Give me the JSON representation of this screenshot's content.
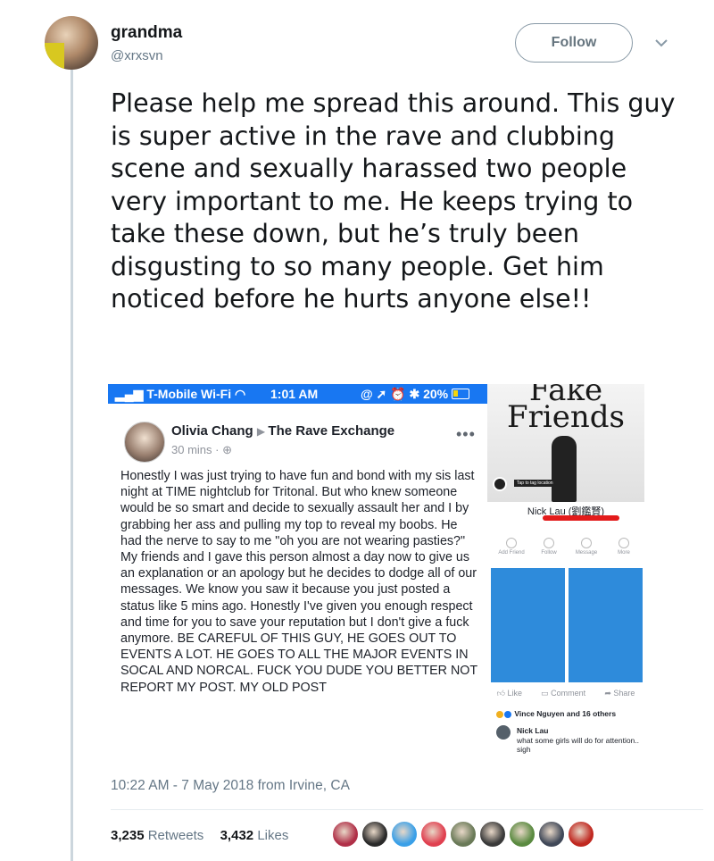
{
  "user": {
    "name": "grandma",
    "handle": "@xrxsvn"
  },
  "follow_label": "Follow",
  "tweet_text": "Please help me spread this around. This guy is super active in the rave and clubbing scene and sexually harassed two people very important to me. He keeps trying to take these down, but he’s truly been disgusting to so many people. Get him noticed before he hurts anyone else!!",
  "screenshot": {
    "status_bar": {
      "carrier": "T-Mobile Wi-Fi",
      "time": "1:01 AM",
      "battery": "20%"
    },
    "post": {
      "author": "Olivia Chang",
      "group": "The Rave Exchange",
      "time": "30 mins",
      "body": "Honestly I was just trying to have fun and bond with my sis last night at TIME nightclub for Tritonal. But who knew someone would be so smart and decide to sexually assault her and I by grabbing her ass and pulling my top to reveal my boobs. He had the nerve to say to me \"oh you are not wearing pasties?\"  My friends and I gave this person almost a day now to give us an explanation or an apology but he decides to dodge all of our messages. We know you saw it because you just posted a status like 5 mins ago. Honestly I've given you enough respect and time for you to save your reputation but I don't give a fuck anymore. BE CAREFUL OF THIS GUY, HE GOES OUT TO EVENTS A LOT. HE GOES TO ALL THE MAJOR EVENTS IN SOCAL AND NORCAL.  FUCK YOU DUDE YOU BETTER NOT REPORT MY POST. MY OLD POST"
    },
    "profile": {
      "cover_title": "Fake Friends",
      "name": "Nick Lau (劉鑑賢)",
      "actions": [
        "Add Friend",
        "Follow",
        "Message",
        "More"
      ],
      "tap_label": "Tap to tag location",
      "like": "Like",
      "comment": "Comment",
      "share": "Share",
      "reactions": "Vince Nguyen and 16 others",
      "commenter": "Nick Lau",
      "comment_text": "what some girls will do for attention.. sigh"
    }
  },
  "timestamp": "10:22 AM - 7 May 2018 from Irvine, CA",
  "stats": {
    "retweets": "3,235",
    "retweets_label": "Retweets",
    "likes": "3,432",
    "likes_label": "Likes"
  },
  "colors": {
    "facebook_blue": "#1877f2",
    "text_gray": "#657786",
    "liker_avatars": [
      "#b03048",
      "#2a2a2a",
      "#3aa0e8",
      "#e04050",
      "#6a7a58",
      "#3a3a3a",
      "#5a8a40",
      "#404858",
      "#c02820"
    ]
  }
}
